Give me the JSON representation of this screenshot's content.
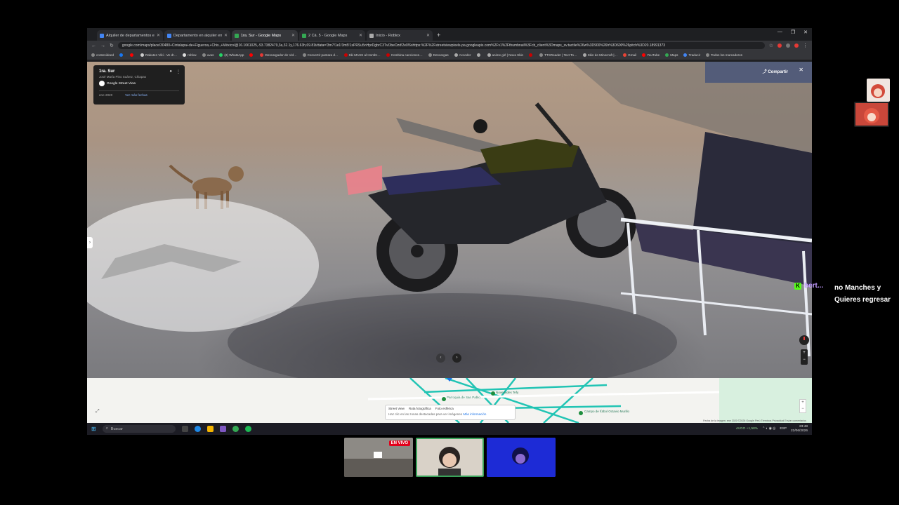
{
  "browser": {
    "tabs": [
      {
        "label": "Alquiler de departamentos en",
        "color": "#4285f4",
        "active": false
      },
      {
        "label": "Departamento en alquiler en 3",
        "color": "#4285f4",
        "active": false
      },
      {
        "label": "1ra. Sur - Google Maps",
        "color": "#34a853",
        "active": true
      },
      {
        "label": "2 Cá. 5 - Google Maps",
        "color": "#34a853",
        "active": false
      },
      {
        "label": "Inicio - Roblox",
        "color": "#aaaaaa",
        "active": false
      }
    ],
    "new_tab": "+",
    "url": "google.com/maps/place/30480+Cintalapa+de+Figueroa,+Chis.,+México/@16.1061025,-93.7382479,3a,32.1y,176.63h,69.81t/data=!3m7!1e1!3m5!1sPRSu5nHprDgbrC3TvObeOzd!2e0!6shttps:%2F%2Fstreetviewpixels-pa.googleapis.com%2Fv1%2Fthumbnail%3Fcb_client%3Dmaps_sv.tactile%26w%3D900%26h%3D600%26pitch%3D20.18991373",
    "bookmarks": [
      {
        "label": "contenidoed",
        "color": "#888888"
      },
      {
        "label": "",
        "color": "#1877f2"
      },
      {
        "label": "",
        "color": "#ff0000"
      },
      {
        "label": "Rakuten Viki - Ve dr…",
        "color": "#cccccc"
      },
      {
        "label": "roblox",
        "color": "#dddddd"
      },
      {
        "label": "uvas",
        "color": "#888888"
      },
      {
        "label": "(2) WhatsApp",
        "color": "#25d366"
      },
      {
        "label": "",
        "color": "#ff0000"
      },
      {
        "label": "Descargador de Vid…",
        "color": "#e53935"
      },
      {
        "label": "Convertir pantara d…",
        "color": "#888888"
      },
      {
        "label": "Ski MASS al Hombr…",
        "color": "#cc0000"
      },
      {
        "label": "Combina canciones…",
        "color": "#cc0000"
      },
      {
        "label": "Descargas",
        "color": "#888888"
      },
      {
        "label": "Acceder",
        "color": "#aaaaaa"
      },
      {
        "label": "",
        "color": "#aaaaaa"
      },
      {
        "label": "anime girl | Nova Skin",
        "color": "#aaaaaa"
      },
      {
        "label": "",
        "color": "#cc0000"
      },
      {
        "label": "TTSReader | Text To…",
        "color": "#888888"
      },
      {
        "label": "Skin de Minecraft |…",
        "color": "#aaaaaa"
      },
      {
        "label": "Gmail",
        "color": "#ea4335"
      },
      {
        "label": "YouTube",
        "color": "#ff0000"
      },
      {
        "label": "Maps",
        "color": "#34a853"
      },
      {
        "label": "Traducir",
        "color": "#4285f4"
      },
      {
        "label": "Todos los marcadores",
        "color": "#888888"
      }
    ]
  },
  "street_view": {
    "place_name": "1ra. Sur",
    "place_location": "José María Pino Suárez, Chiapas",
    "badge": "Google Street View",
    "date": "ene 2020",
    "more_dates": "Ver más fechas",
    "share": "Compartir",
    "close": "✕"
  },
  "minimap": {
    "labels": [
      {
        "text": "Parroquia de San Pablo…"
      },
      {
        "text": "Novedades Tefy"
      },
      {
        "text": "Campo de fútbol Octavio Murillo"
      }
    ],
    "layers": [
      "Street View",
      "Ruta fotográfica",
      "Foto esférica"
    ],
    "hint": "Haz clic en las zonas destacadas para ver imágenes",
    "hint_link": "Más información",
    "footer": "Fecha de la imagen: ene 2020  ©2026 Google  Perú  Términos  Privacidad  Enviar comentarios"
  },
  "taskbar": {
    "search_placeholder": "Buscar",
    "ticker": "AVGO +1,58%",
    "lang": "ESP",
    "time": "23:48",
    "date": "22/06/2026"
  },
  "stream": {
    "chat_user": "bert...",
    "chat_message": "no Manches y Quieres regresar",
    "live_label": "EN VIVO"
  }
}
